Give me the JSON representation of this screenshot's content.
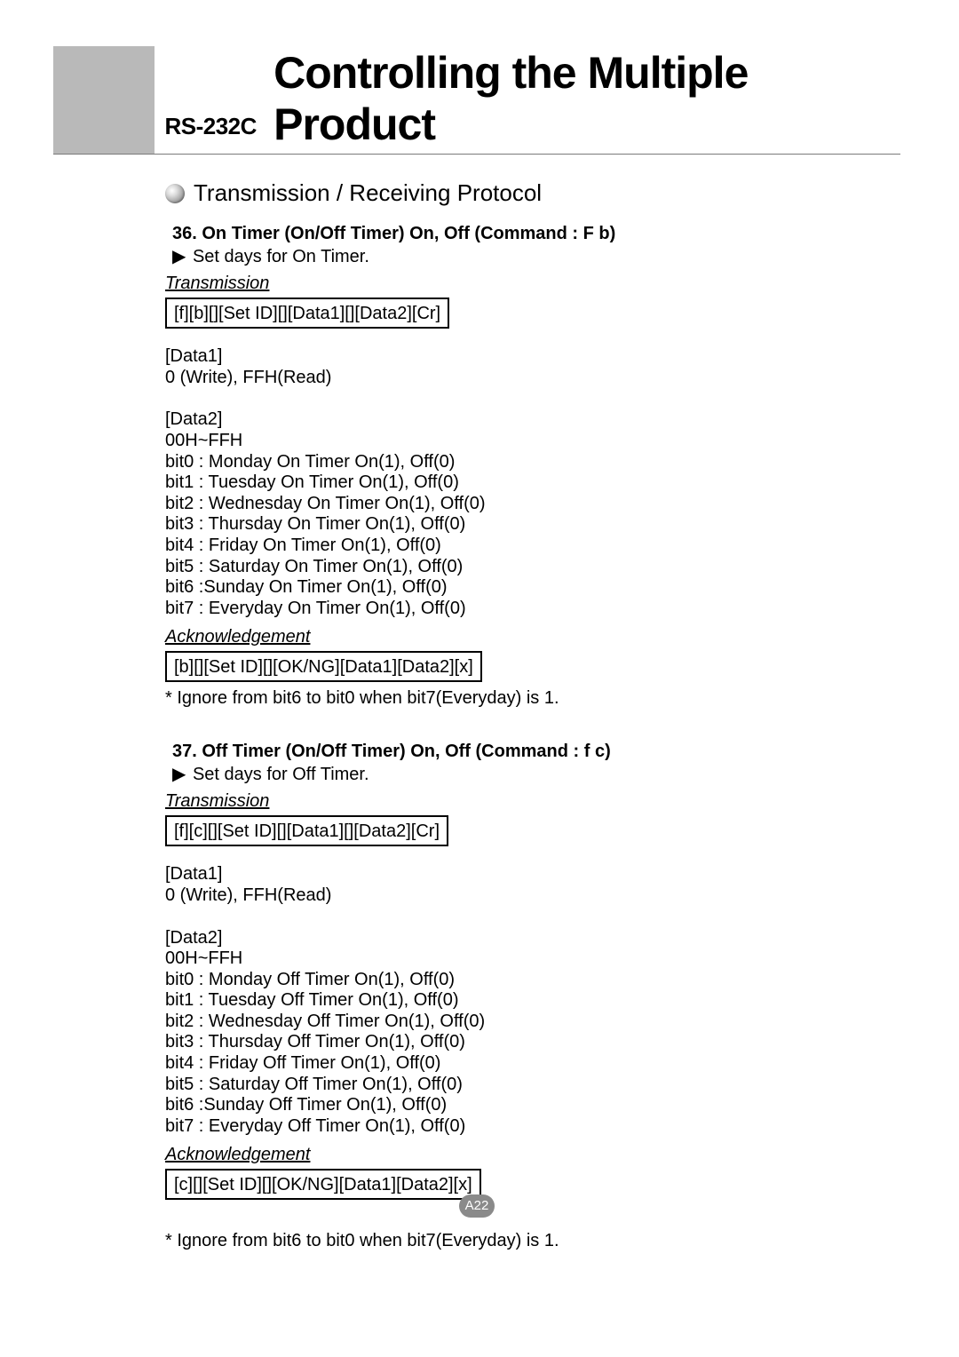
{
  "header": {
    "label": "RS-232C",
    "title": "Controlling the Multiple Product"
  },
  "sectionTitle": "Transmission / Receiving Protocol",
  "sec36": {
    "title": "36. On Timer (On/Off Timer) On, Off (Command : F b)",
    "setLine": "Set days for On Timer.",
    "transLabel": "Transmission",
    "transCode": "[f][b][][Set ID][][Data1][][Data2][Cr]",
    "data1": {
      "label": "[Data1]",
      "line": "0 (Write), FFH(Read)"
    },
    "data2": {
      "label": "[Data2]",
      "range": "00H~FFH",
      "bits": [
        "bit0 : Monday On Timer On(1), Off(0)",
        "bit1 : Tuesday On Timer On(1), Off(0)",
        "bit2 : Wednesday On Timer On(1), Off(0)",
        "bit3 : Thursday On Timer On(1), Off(0)",
        "bit4 : Friday On Timer On(1), Off(0)",
        "bit5 : Saturday On Timer On(1), Off(0)",
        "bit6 :Sunday On Timer On(1), Off(0)",
        "bit7 : Everyday On Timer On(1), Off(0)"
      ]
    },
    "ackLabel": "Acknowledgement",
    "ackCode": "[b][][Set ID][][OK/NG][Data1][Data2][x]",
    "note": "* Ignore from bit6 to bit0 when bit7(Everyday) is 1."
  },
  "sec37": {
    "title": "37. Off Timer (On/Off Timer) On, Off (Command : f c)",
    "setLine": "Set days for Off Timer.",
    "transLabel": "Transmission",
    "transCode": "[f][c][][Set ID][][Data1][][Data2][Cr]",
    "data1": {
      "label": "[Data1]",
      "line": "0 (Write), FFH(Read)"
    },
    "data2": {
      "label": "[Data2]",
      "range": "00H~FFH",
      "bits": [
        "bit0 : Monday Off Timer On(1), Off(0)",
        "bit1 : Tuesday Off Timer On(1), Off(0)",
        "bit2 : Wednesday Off Timer On(1), Off(0)",
        "bit3 : Thursday Off Timer On(1), Off(0)",
        "bit4 : Friday Off Timer On(1), Off(0)",
        "bit5 : Saturday Off Timer On(1), Off(0)",
        "bit6 :Sunday Off Timer On(1), Off(0)",
        "bit7 : Everyday Off Timer On(1), Off(0)"
      ]
    },
    "ackLabel": "Acknowledgement",
    "ackCode": "[c][][Set ID][][OK/NG][Data1][Data2][x]",
    "note": "* Ignore from bit6 to bit0 when bit7(Everyday) is 1."
  },
  "pageNum": "A22",
  "arrow": "▶"
}
